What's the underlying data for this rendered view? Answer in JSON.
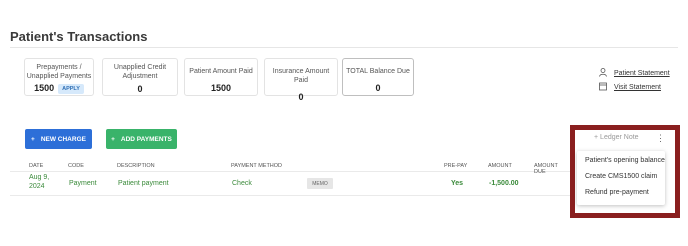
{
  "page": {
    "title": "Patient's Transactions"
  },
  "summary": {
    "prepayments": {
      "label_line1": "Prepayments /",
      "label_line2": "Unapplied Payments",
      "value": "1500",
      "badge": "APPLY"
    },
    "unapplied_credit": {
      "label_line1": "Unapplied Credit",
      "label_line2": "Adjustment",
      "value": "0"
    },
    "patient_amount_paid": {
      "label": "Patient Amount Paid",
      "value": "1500"
    },
    "insurance_amount_paid": {
      "label": "Insurance Amount Paid",
      "value": "0"
    },
    "total_balance_due": {
      "label": "TOTAL Balance Due",
      "value": "0"
    }
  },
  "links": {
    "patient_statement": "Patient Statement",
    "visit_statement": "Visit Statement"
  },
  "actions": {
    "new_charge": "NEW CHARGE",
    "add_payments": "ADD PAYMENTS",
    "ledger_note": "Ledger Note"
  },
  "table": {
    "headers": {
      "date": "DATE",
      "code": "CODE",
      "description": "DESCRIPTION",
      "payment_method": "PAYMENT METHOD",
      "pre_pay": "PRE-PAY",
      "amount": "AMOUNT",
      "amount_due": "AMOUNT DUE"
    },
    "rows": [
      {
        "date_line1": "Aug 9,",
        "date_line2": "2024",
        "code": "Payment",
        "description": "Patient payment",
        "payment_method": "Check",
        "memo": "MEMO",
        "pre_pay": "Yes",
        "amount": "-1,500.00"
      }
    ]
  },
  "menu": {
    "items": [
      "Patient's opening balance",
      "Create CMS1500 claim",
      "Refund pre-payment"
    ]
  },
  "colors": {
    "primary": "#2d6fd8",
    "success": "#39b36a",
    "highlight": "#8a1f1f"
  }
}
